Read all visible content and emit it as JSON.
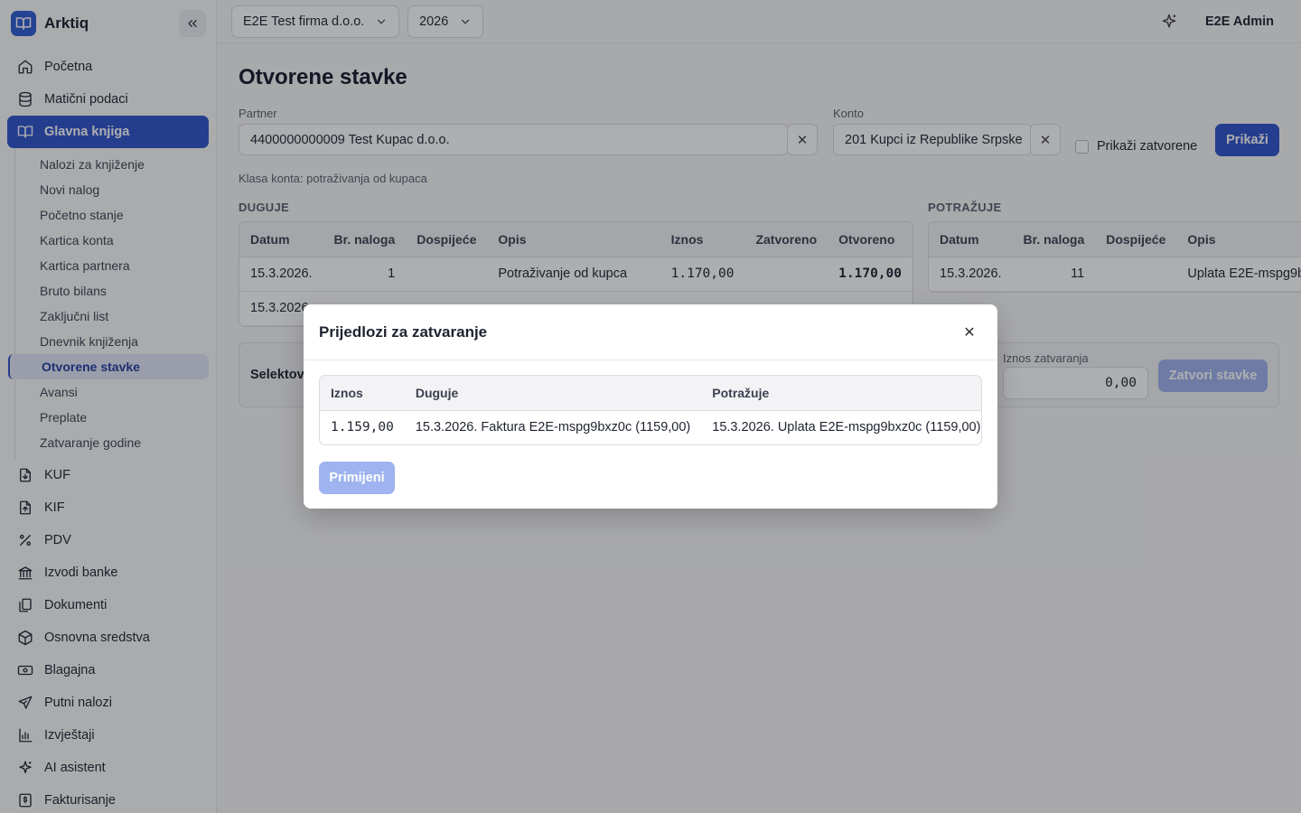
{
  "brand": {
    "name": "Arktiq"
  },
  "nav": {
    "items": [
      {
        "label": "Početna",
        "icon": "home-icon"
      },
      {
        "label": "Matični podaci",
        "icon": "database-icon"
      },
      {
        "label": "Glavna knjiga",
        "icon": "book-icon",
        "active": true
      }
    ],
    "sub_items": [
      "Nalozi za knjiženje",
      "Novi nalog",
      "Početno stanje",
      "Kartica konta",
      "Kartica partnera",
      "Bruto bilans",
      "Zaključni list",
      "Dnevnik knjiženja",
      "Otvorene stavke",
      "Avansi",
      "Preplate",
      "Zatvaranje godine"
    ],
    "active_sub": "Otvorene stavke",
    "lower_items": [
      {
        "label": "KUF",
        "icon": "file-download-icon"
      },
      {
        "label": "KIF",
        "icon": "file-upload-icon"
      },
      {
        "label": "PDV",
        "icon": "percent-icon"
      },
      {
        "label": "Izvodi banke",
        "icon": "bank-icon"
      },
      {
        "label": "Dokumenti",
        "icon": "documents-icon"
      },
      {
        "label": "Osnovna sredstva",
        "icon": "box-icon"
      },
      {
        "label": "Blagajna",
        "icon": "cash-icon"
      },
      {
        "label": "Putni nalozi",
        "icon": "plane-icon"
      },
      {
        "label": "Izvještaji",
        "icon": "bar-chart-icon"
      },
      {
        "label": "AI asistent",
        "icon": "sparkle-icon"
      },
      {
        "label": "Fakturisanje",
        "icon": "invoice-icon"
      }
    ]
  },
  "topbar": {
    "company": "E2E Test firma d.o.o.",
    "year": "2026",
    "user": "E2E Admin"
  },
  "page": {
    "title": "Otvorene stavke",
    "partner_label": "Partner",
    "partner_value": "4400000000009 Test Kupac d.o.o.",
    "konto_label": "Konto",
    "konto_value": "201 Kupci iz Republike Srpske",
    "show_closed_label": "Prikaži zatvorene",
    "show_button": "Prikaži",
    "account_class": "Klasa konta: potraživanja od kupaca",
    "duguje_title": "DUGUJE",
    "potrazuje_title": "POTRAŽUJE",
    "duguje_columns": [
      "Datum",
      "Br. naloga",
      "Dospijeće",
      "Opis",
      "Iznos",
      "Zatvoreno",
      "Otvoreno"
    ],
    "duguje_rows": [
      {
        "datum": "15.3.2026.",
        "nalog": "1",
        "dospijece": "",
        "opis": "Potraživanje od kupca",
        "iznos": "1.170,00",
        "zatvoreno": "",
        "otvoreno": "1.170,00"
      },
      {
        "datum": "15.3.2026.",
        "nalog": "",
        "dospijece": "",
        "opis": "",
        "iznos": "",
        "zatvoreno": "",
        "otvoreno": ""
      }
    ],
    "potrazuje_columns": [
      "Datum",
      "Br. naloga",
      "Dospijeće",
      "Opis"
    ],
    "potrazuje_rows": [
      {
        "datum": "15.3.2026.",
        "nalog": "11",
        "dospijece": "",
        "opis": "Uplata E2E-mspg9b"
      }
    ],
    "selection_label": "Selektov",
    "closing_amount_label": "Iznos zatvaranja",
    "closing_amount_value": "0,00",
    "close_button": "Zatvori stavke"
  },
  "modal": {
    "title": "Prijedlozi za zatvaranje",
    "columns": [
      "Iznos",
      "Duguje",
      "Potražuje"
    ],
    "rows": [
      {
        "iznos": "1.159,00",
        "duguje": "15.3.2026. Faktura E2E-mspg9bxz0c (1159,00)",
        "potrazuje": "15.3.2026. Uplata E2E-mspg9bxz0c (1159,00)"
      }
    ],
    "apply_button": "Primijeni"
  },
  "colors": {
    "accent": "#2f52c9",
    "accent_disabled": "#9eb3ef"
  }
}
